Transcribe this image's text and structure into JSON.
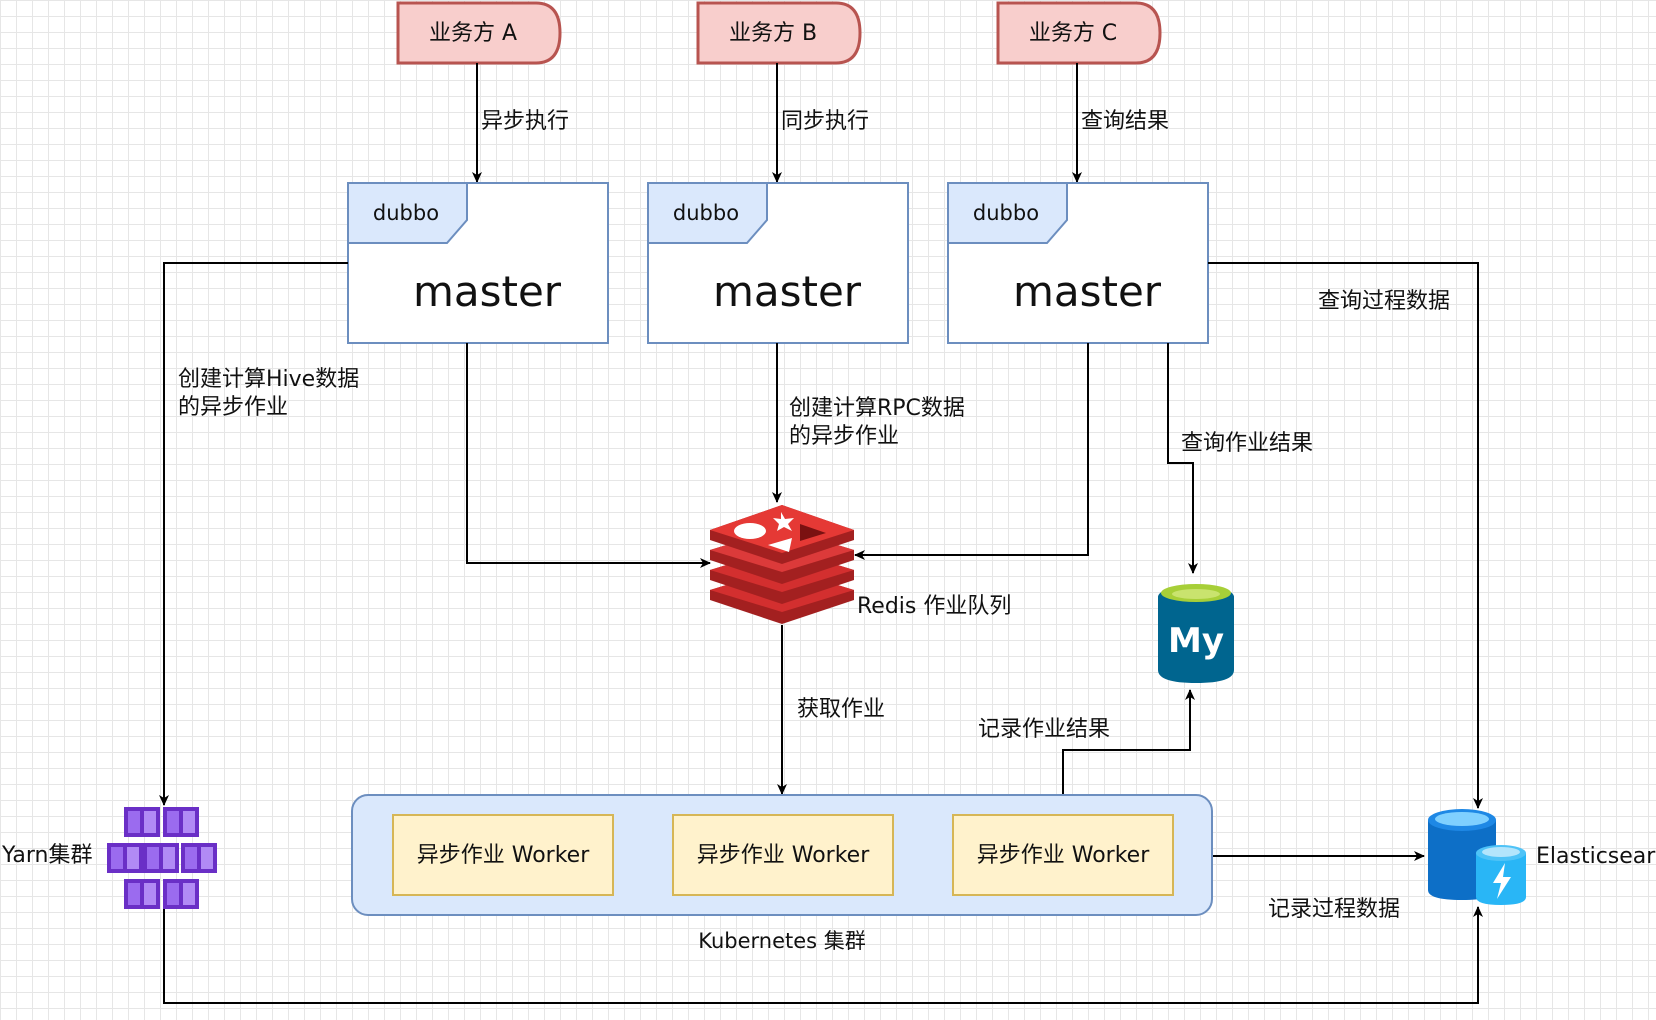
{
  "callers": [
    {
      "label": "业务方 A",
      "edge_label": "异步执行"
    },
    {
      "label": "业务方 B",
      "edge_label": "同步执行"
    },
    {
      "label": "业务方 C",
      "edge_label": "查询结果"
    }
  ],
  "masters": [
    {
      "tag": "dubbo",
      "title": "master"
    },
    {
      "tag": "dubbo",
      "title": "master"
    },
    {
      "tag": "dubbo",
      "title": "master"
    }
  ],
  "edges": {
    "create_hive_job": [
      "创建计算Hive数据",
      "的异步作业"
    ],
    "create_rpc_job": [
      "创建计算RPC数据",
      "的异步作业"
    ],
    "query_job_result": "查询作业结果",
    "query_process_data": "查询过程数据",
    "fetch_job": "获取作业",
    "record_job_result": "记录作业结果",
    "record_process_data": "记录过程数据"
  },
  "redis": {
    "label": "Redis 作业队列"
  },
  "mysql": {
    "icon": "mysql-icon",
    "text": "My"
  },
  "kubernetes": {
    "label": "Kubernetes 集群",
    "workers": [
      "异步作业 Worker",
      "异步作业 Worker",
      "异步作业 Worker"
    ]
  },
  "yarn": {
    "label": "Yarn集群",
    "icon": "yarn-cluster-icon"
  },
  "elasticsearch": {
    "label": "Elasticsearch",
    "icon": "elasticsearch-icon"
  },
  "colors": {
    "caller_fill": "#f8cecc",
    "caller_stroke": "#b85450",
    "master_stroke": "#6c8ebf",
    "tag_fill": "#dae8fc",
    "cluster_fill": "#dae8fc",
    "worker_fill": "#fff2cc",
    "worker_stroke": "#d6b656",
    "redis_red": "#c62828",
    "mysql_blue": "#00658f",
    "mysql_green": "#a7cf38",
    "yarn_purple": "#7b3fd6",
    "es_blue": "#1e88e5"
  }
}
